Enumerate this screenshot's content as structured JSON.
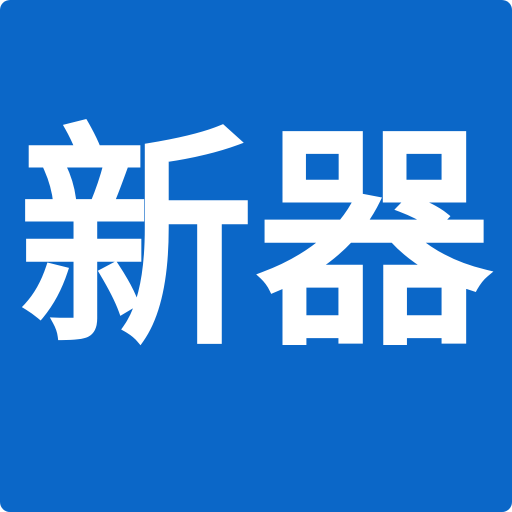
{
  "logo": {
    "text": "新器",
    "background_color": "#0b67c8",
    "text_color": "#ffffff"
  }
}
